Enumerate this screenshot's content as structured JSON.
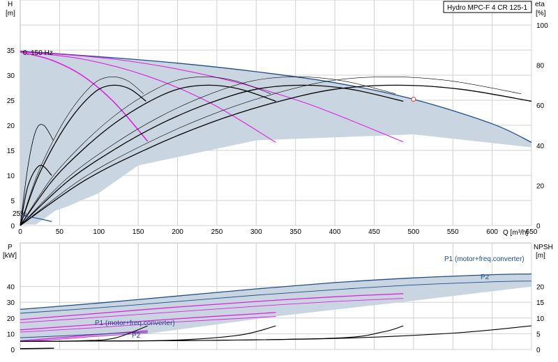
{
  "chart_data": [
    {
      "type": "line",
      "title": "Hydro MPC-F 4 CR 125-1",
      "xlabel": "Q [m³/h]",
      "ylabel_left_top": "H",
      "ylabel_left_bottom": "[m]",
      "ylabel_right_top": "eta",
      "ylabel_right_bottom": "[%]",
      "xlim": [
        0,
        650
      ],
      "ylim_left": [
        0,
        40
      ],
      "ylim_right": [
        0,
        100
      ],
      "x_ticks": [
        0,
        50,
        100,
        150,
        200,
        250,
        300,
        350,
        400,
        450,
        500,
        550,
        600,
        650
      ],
      "y_ticks_left": [
        0,
        5,
        10,
        15,
        20,
        25,
        30,
        35
      ],
      "y_ticks_right": [
        0,
        20,
        40,
        60,
        80,
        100
      ],
      "grid": true,
      "annotations": [
        "0: 150 Hz",
        "25%"
      ],
      "duty_point": {
        "q": 500,
        "h": 25.2
      },
      "series": [
        {
          "role": "envelope-top",
          "x": [
            0,
            100,
            200,
            300,
            400,
            500,
            600,
            650
          ],
          "y": [
            34.8,
            33.7,
            32.4,
            30.7,
            28.5,
            25.2,
            20.3,
            16.6
          ]
        },
        {
          "role": "head-1",
          "x": [
            0,
            40,
            80,
            120,
            162
          ],
          "y": [
            34.6,
            33,
            29.8,
            24.5,
            16.8
          ]
        },
        {
          "role": "head-2",
          "x": [
            0,
            80,
            160,
            240,
            325
          ],
          "y": [
            34.7,
            33.2,
            29.9,
            24.6,
            16.6
          ]
        },
        {
          "role": "head-3",
          "x": [
            0,
            120,
            240,
            360,
            487
          ],
          "y": [
            34.7,
            33.2,
            29.9,
            24.6,
            16.7
          ]
        },
        {
          "role": "eta-1",
          "x": [
            0,
            20,
            40,
            60,
            80,
            100,
            120,
            140,
            160
          ],
          "y": [
            0,
            22,
            38,
            51,
            61,
            68,
            70,
            68,
            62
          ]
        },
        {
          "role": "eta-2",
          "x": [
            0,
            40,
            80,
            120,
            160,
            200,
            240,
            280,
            325
          ],
          "y": [
            0,
            22,
            38,
            51,
            61,
            68,
            70,
            68,
            62
          ]
        },
        {
          "role": "eta-3",
          "x": [
            0,
            60,
            120,
            180,
            240,
            300,
            360,
            420,
            487
          ],
          "y": [
            0,
            22,
            38,
            51,
            61,
            68,
            70,
            68,
            62
          ]
        },
        {
          "role": "eta-4",
          "x": [
            0,
            80,
            160,
            240,
            320,
            400,
            480,
            560,
            650
          ],
          "y": [
            0,
            22,
            38,
            51,
            61,
            68,
            70,
            68,
            62
          ]
        }
      ]
    },
    {
      "type": "line",
      "xlim": [
        0,
        650
      ],
      "ylabel_left_top": "P",
      "ylabel_left_bottom": "[kW]",
      "ylabel_right_top": "NPSH",
      "ylabel_right_bottom": "[m]",
      "ylim_left": [
        0,
        50
      ],
      "ylim_right": [
        0,
        25
      ],
      "y_ticks_left": [
        0,
        10,
        20,
        30,
        40
      ],
      "y_ticks_right": [
        0,
        5,
        10,
        15,
        20
      ],
      "grid": true,
      "labels": {
        "p1_top": "P1 (motor+freq.converter)",
        "p2_top": "P2",
        "p1_small": "P1 (motor+freq.converter)",
        "p2_small": "P2"
      },
      "series": [
        {
          "role": "p1-4",
          "x": [
            0,
            100,
            200,
            300,
            400,
            500,
            600,
            650
          ],
          "y": [
            25.5,
            29.5,
            34,
            38.5,
            42.5,
            45.5,
            47.5,
            48
          ]
        },
        {
          "role": "p2-4",
          "x": [
            0,
            100,
            200,
            300,
            400,
            500,
            600,
            650
          ],
          "y": [
            23,
            26.5,
            30.5,
            34.5,
            38,
            41,
            43,
            43.5
          ]
        },
        {
          "role": "p1-3",
          "x": [
            0,
            100,
            200,
            300,
            400,
            487
          ],
          "y": [
            19,
            23,
            27,
            30.5,
            33.5,
            35.5
          ]
        },
        {
          "role": "p2-3",
          "x": [
            0,
            100,
            200,
            300,
            400,
            487
          ],
          "y": [
            17,
            20.5,
            24,
            27.5,
            30.5,
            32.5
          ]
        },
        {
          "role": "p1-2",
          "x": [
            0,
            100,
            200,
            325
          ],
          "y": [
            12.5,
            16,
            19.5,
            23.5
          ]
        },
        {
          "role": "p2-2",
          "x": [
            0,
            100,
            200,
            325
          ],
          "y": [
            11,
            14,
            17.5,
            21
          ]
        },
        {
          "role": "p1-1",
          "x": [
            0,
            50,
            100,
            162
          ],
          "y": [
            5.5,
            7.5,
            9.5,
            12
          ]
        },
        {
          "role": "p2-1",
          "x": [
            0,
            50,
            100,
            162
          ],
          "y": [
            5,
            6.5,
            8.5,
            10.5
          ]
        },
        {
          "role": "npsh-1",
          "x": [
            0,
            40,
            80,
            120,
            162
          ],
          "y": [
            2.6,
            2.6,
            2.8,
            3.6,
            7.5
          ]
        },
        {
          "role": "npsh-2",
          "x": [
            0,
            100,
            200,
            280,
            325
          ],
          "y": [
            2.6,
            2.7,
            3.0,
            4.6,
            7.5
          ]
        },
        {
          "role": "npsh-3",
          "x": [
            0,
            200,
            400,
            460,
            487
          ],
          "y": [
            2.6,
            2.8,
            3.6,
            5.5,
            7.5
          ]
        },
        {
          "role": "npsh-4",
          "x": [
            0,
            200,
            400,
            550,
            650
          ],
          "y": [
            2.6,
            2.8,
            3.5,
            5.2,
            7.5
          ]
        }
      ]
    }
  ]
}
